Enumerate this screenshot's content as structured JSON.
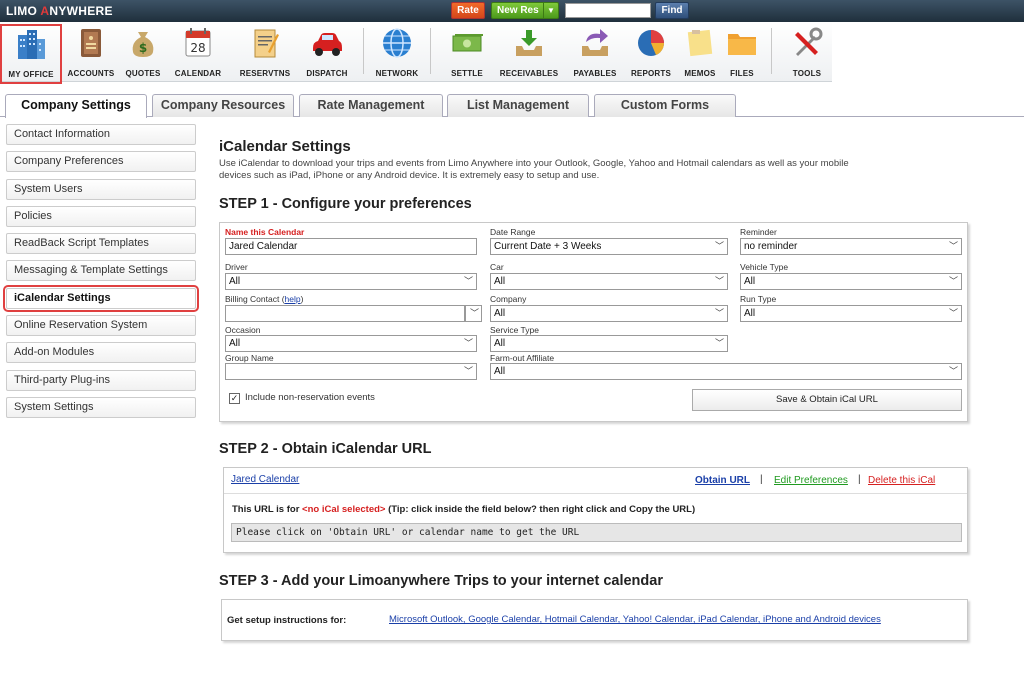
{
  "header": {
    "logo_text_1": "LIMO ",
    "logo_text_2": "A",
    "logo_text_3": "NYWHERE",
    "rate_label": "Rate",
    "new_res_label": "New Res",
    "find_label": "Find"
  },
  "toolbar": {
    "items": [
      {
        "label": "MY OFFICE"
      },
      {
        "label": "ACCOUNTS"
      },
      {
        "label": "QUOTES"
      },
      {
        "label": "CALENDAR"
      },
      {
        "label": "RESERVTNS"
      },
      {
        "label": "DISPATCH"
      },
      {
        "label": "NETWORK"
      },
      {
        "label": "SETTLE"
      },
      {
        "label": "RECEIVABLES"
      },
      {
        "label": "PAYABLES"
      },
      {
        "label": "REPORTS"
      },
      {
        "label": "MEMOS"
      },
      {
        "label": "FILES"
      },
      {
        "label": "TOOLS"
      }
    ],
    "calendar_day": "28"
  },
  "tabs": [
    {
      "label": "Company Settings"
    },
    {
      "label": "Company Resources"
    },
    {
      "label": "Rate Management"
    },
    {
      "label": "List Management"
    },
    {
      "label": "Custom Forms"
    }
  ],
  "sidebar": {
    "items": [
      {
        "label": "Contact Information"
      },
      {
        "label": "Company Preferences"
      },
      {
        "label": "System Users"
      },
      {
        "label": "Policies"
      },
      {
        "label": "ReadBack Script Templates"
      },
      {
        "label": "Messaging & Template Settings"
      },
      {
        "label": "iCalendar Settings"
      },
      {
        "label": "Online Reservation System"
      },
      {
        "label": "Add-on Modules"
      },
      {
        "label": "Third-party Plug-ins"
      },
      {
        "label": "System Settings"
      }
    ]
  },
  "main": {
    "title": "iCalendar Settings",
    "intro": "Use iCalendar to download your trips and events from Limo Anywhere into your Outlook, Google, Yahoo and Hotmail calendars as well as your mobile devices such as iPad, iPhone or any Android device. It is extremely easy to setup and use.",
    "step1": {
      "title": "STEP 1 - Configure your preferences",
      "name_label": "Name this Calendar",
      "name_value": "Jared Calendar",
      "date_range_label": "Date Range",
      "date_range_value": "Current Date + 3 Weeks",
      "reminder_label": "Reminder",
      "reminder_value": "no reminder",
      "driver_label": "Driver",
      "driver_value": "All",
      "car_label": "Car",
      "car_value": "All",
      "vehicle_type_label": "Vehicle Type",
      "vehicle_type_value": "All",
      "billing_label": "Billing Contact (",
      "billing_help": "help",
      "billing_close": ")",
      "billing_value": "",
      "company_label": "Company",
      "company_value": "All",
      "run_type_label": "Run Type",
      "run_type_value": "All",
      "occasion_label": "Occasion",
      "occasion_value": "All",
      "service_type_label": "Service Type",
      "service_type_value": "All",
      "group_label": "Group Name",
      "group_value": "",
      "farmout_label": "Farm-out Affiliate",
      "farmout_value": "All",
      "include_label": "Include non-reservation events",
      "include_checked": "✓",
      "save_label": "Save & Obtain iCal URL"
    },
    "step2": {
      "title": "STEP 2 - Obtain iCalendar URL",
      "calendar_link": "Jared Calendar",
      "obtain_url": "Obtain URL",
      "pipe1": "|",
      "edit_prefs": "Edit Preferences",
      "pipe2": "|",
      "delete_ical": "Delete this iCal",
      "url_for_1": "This URL is for ",
      "url_for_none": "<no iCal selected>",
      "url_for_tip": " (Tip: click inside the field below? then right click and Copy the URL)",
      "url_placeholder": "Please click on 'Obtain URL' or calendar name to get the URL"
    },
    "step3": {
      "title": "STEP 3 - Add your Limoanywhere Trips to your internet calendar",
      "instructions_label": "Get setup instructions for:",
      "instructions_link": "Microsoft Outlook, Google Calendar, Hotmail Calendar, Yahoo! Calendar, iPad Calendar, iPhone and Android devices"
    }
  },
  "colors": {
    "required": "#d62020",
    "link": "#1a3fa8",
    "edit_link": "#1f9a1f",
    "delete_link": "#d62020",
    "highlight": "#e04040"
  }
}
